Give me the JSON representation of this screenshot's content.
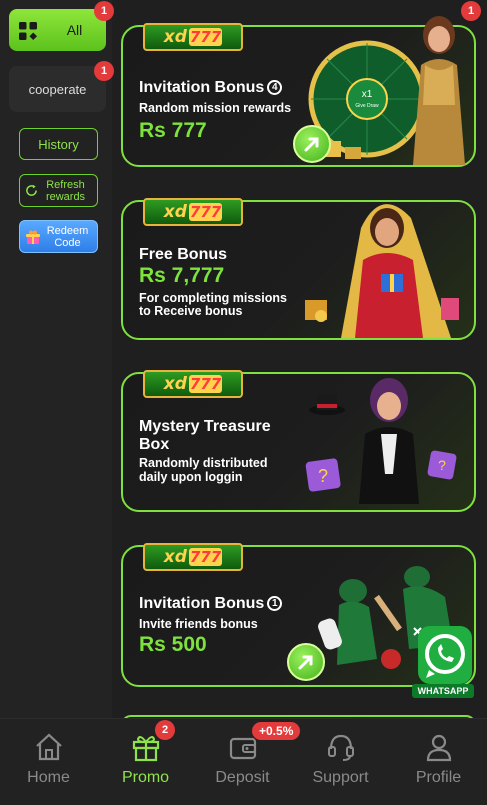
{
  "sidebar": {
    "tabs": [
      {
        "label": "All",
        "badge": "1"
      },
      {
        "label": "cooperate",
        "badge": "1"
      }
    ],
    "history_label": "History",
    "refresh_label": "Refresh rewards",
    "redeem_label": "Redeem Code"
  },
  "promos": [
    {
      "logo": "xd777",
      "title": "Invitation Bonus",
      "title_num": "4",
      "desc": "Random mission rewards",
      "amount": "Rs 777",
      "badge": "1",
      "wheel_text": "x1",
      "wheel_sub": "Give Draw"
    },
    {
      "logo": "xd777",
      "title": "Free Bonus",
      "amount": "Rs 7,777",
      "desc_line1": "For completing missions",
      "desc_line2": "to Receive bonus"
    },
    {
      "logo": "xd777",
      "title_line1": "Mystery Treasure",
      "title_line2": "Box",
      "desc_line1": "Randomly distributed",
      "desc_line2": "daily upon loggin"
    },
    {
      "logo": "xd777",
      "title": "Invitation Bonus",
      "title_num": "1",
      "desc": "Invite friends bonus",
      "amount": "Rs 500"
    }
  ],
  "whatsapp_label": "WHATSAPP",
  "bottom_nav": [
    {
      "label": "Home",
      "icon": "home-icon"
    },
    {
      "label": "Promo",
      "icon": "gift-icon",
      "badge": "2",
      "active": true
    },
    {
      "label": "Deposit",
      "icon": "wallet-icon",
      "badge": "+0.5%"
    },
    {
      "label": "Support",
      "icon": "headset-icon"
    },
    {
      "label": "Profile",
      "icon": "user-icon"
    }
  ],
  "colors": {
    "accent": "#7ee23d",
    "badge": "#e33b3b",
    "background": "#1f1f1f"
  }
}
